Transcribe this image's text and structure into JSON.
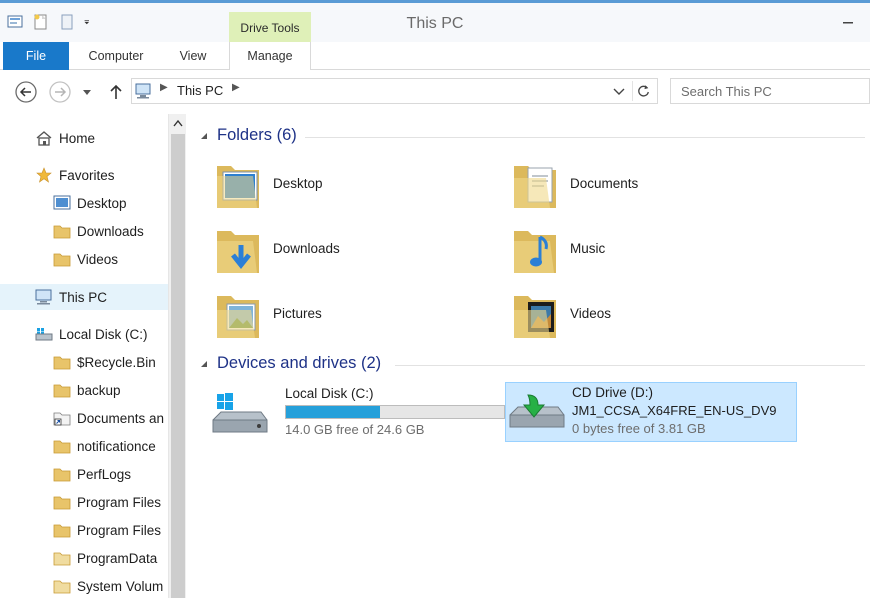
{
  "window": {
    "title": "This PC",
    "contextual_tab": "Drive Tools"
  },
  "ribbon": {
    "tabs": [
      "File",
      "Computer",
      "View",
      "Manage"
    ]
  },
  "address": {
    "location": "This PC"
  },
  "search": {
    "placeholder": "Search This PC"
  },
  "nav": {
    "items": [
      {
        "label": "Home",
        "icon": "home-icon"
      },
      {
        "label": "Favorites",
        "icon": "star-icon"
      },
      {
        "label": "Desktop",
        "icon": "desktop-icon"
      },
      {
        "label": "Downloads",
        "icon": "folder-icon"
      },
      {
        "label": "Videos",
        "icon": "folder-icon"
      },
      {
        "label": "This PC",
        "icon": "computer-icon"
      },
      {
        "label": "Local Disk (C:)",
        "icon": "drive-icon"
      },
      {
        "label": "$Recycle.Bin",
        "icon": "folder-icon"
      },
      {
        "label": "backup",
        "icon": "folder-icon"
      },
      {
        "label": "Documents an",
        "icon": "shortcut-folder-icon"
      },
      {
        "label": "notificationce",
        "icon": "folder-icon"
      },
      {
        "label": "PerfLogs",
        "icon": "folder-icon"
      },
      {
        "label": "Program Files",
        "icon": "folder-icon"
      },
      {
        "label": "Program Files",
        "icon": "folder-icon"
      },
      {
        "label": "ProgramData",
        "icon": "folder-icon"
      },
      {
        "label": "System Volum",
        "icon": "folder-icon"
      }
    ]
  },
  "content": {
    "folders_header": "Folders (6)",
    "folders": [
      {
        "name": "Desktop",
        "icon": "desktop-folder-icon"
      },
      {
        "name": "Documents",
        "icon": "documents-folder-icon"
      },
      {
        "name": "Downloads",
        "icon": "downloads-folder-icon"
      },
      {
        "name": "Music",
        "icon": "music-folder-icon"
      },
      {
        "name": "Pictures",
        "icon": "pictures-folder-icon"
      },
      {
        "name": "Videos",
        "icon": "videos-folder-icon"
      }
    ],
    "drives_header": "Devices and drives (2)",
    "drives": [
      {
        "name": "Local Disk (C:)",
        "free": "14.0 GB free of 24.6 GB",
        "used_fraction": 0.43
      },
      {
        "name": "CD Drive (D:)",
        "label": "JM1_CCSA_X64FRE_EN-US_DV9",
        "free": "0 bytes free of 3.81 GB"
      }
    ]
  },
  "colors": {
    "accent": "#1979ca",
    "drive_tools": "#dff0b8",
    "selection": "#cce8ff",
    "progress": "#26a0da"
  }
}
